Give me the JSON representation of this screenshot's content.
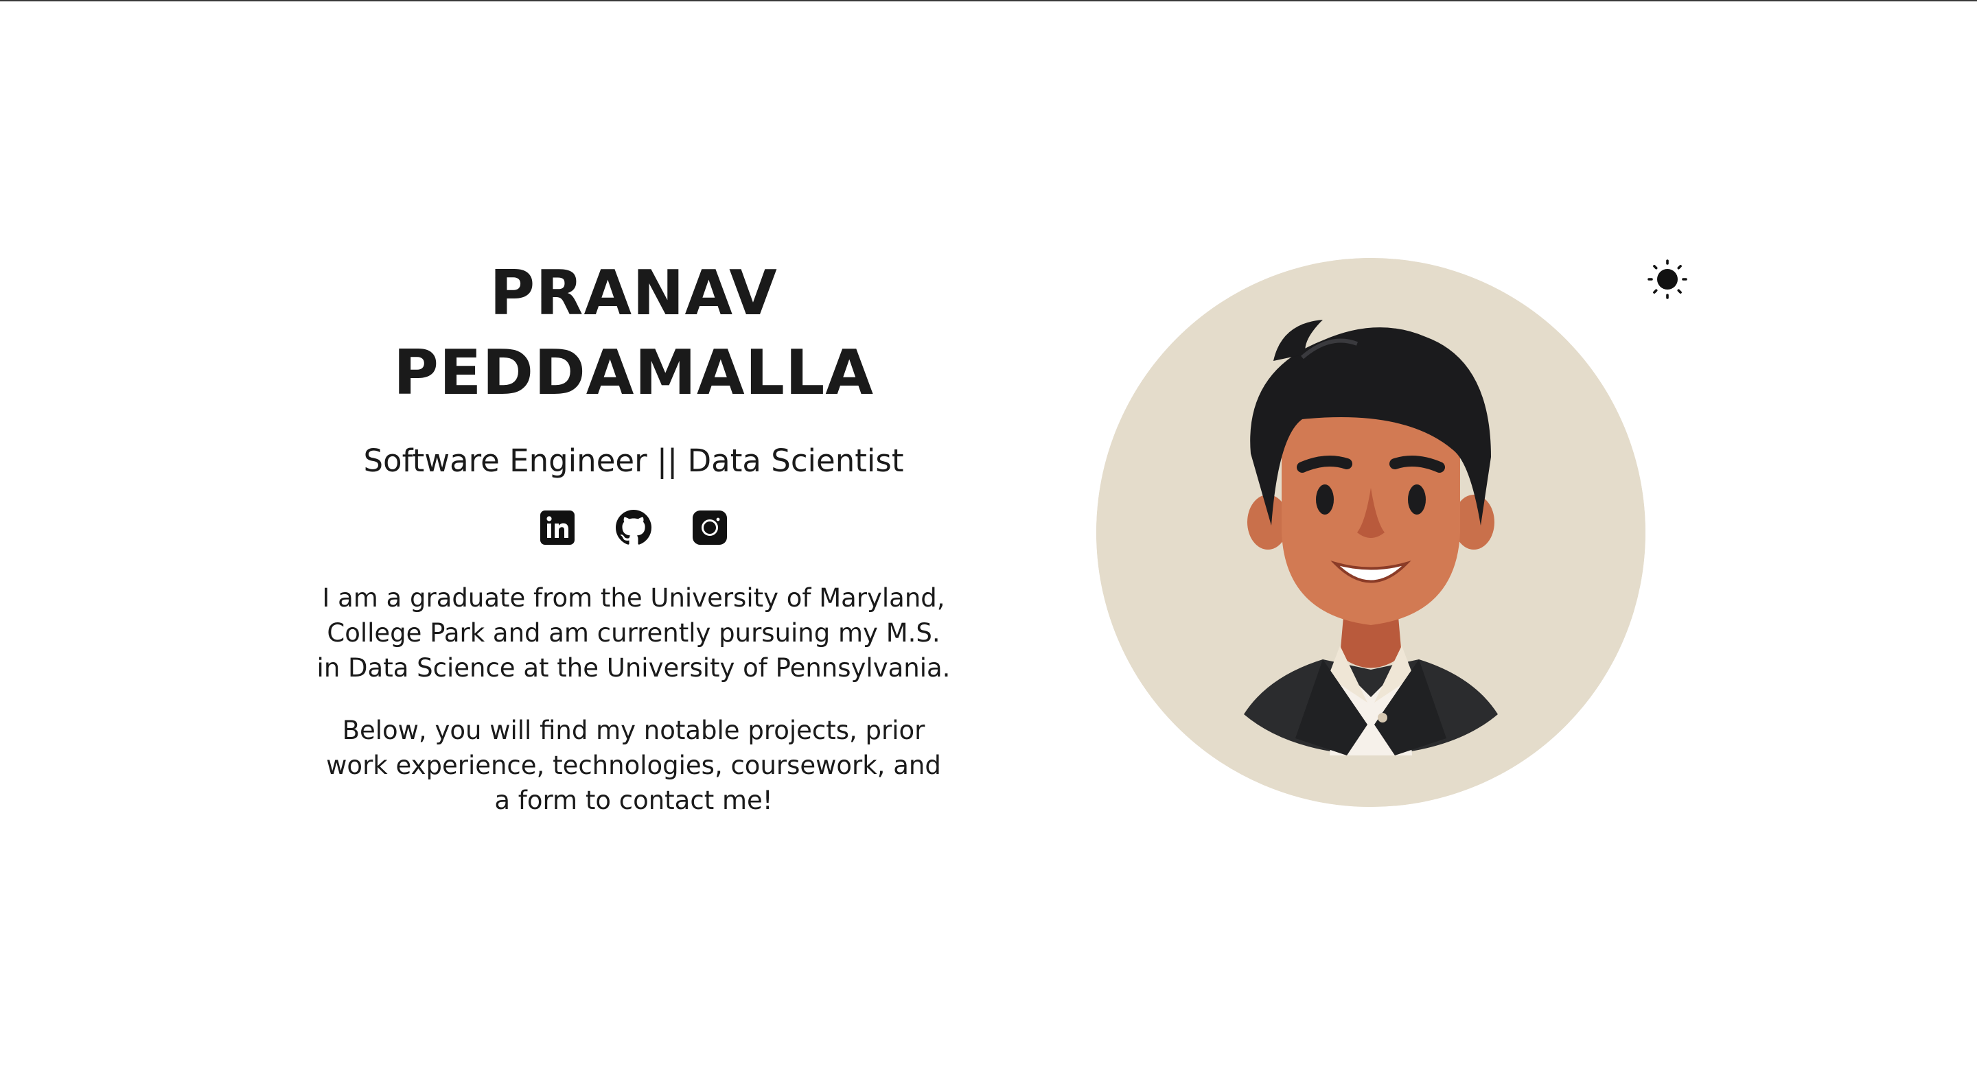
{
  "hero": {
    "name_line1": "PRANAV",
    "name_line2": "PEDDAMALLA",
    "subtitle": "Software Engineer || Data Scientist",
    "bio_paragraph1": "I am a graduate from the University of Maryland, College Park and am currently pursuing my M.S. in Data Science at the University of Pennsylvania.",
    "bio_paragraph2": "Below, you will find my notable projects, prior work experience, technologies, coursework, and a form to contact me!"
  },
  "socials": [
    {
      "icon": "linkedin-icon"
    },
    {
      "icon": "github-icon"
    },
    {
      "icon": "instagram-icon"
    }
  ],
  "theme_toggle": {
    "icon": "sun-icon"
  },
  "avatar": {
    "icon": "avatar-illustration"
  },
  "colors": {
    "text": "#1a1a1a",
    "background": "#ffffff",
    "avatar_bg": "#e4dccb",
    "skin": "#d27a53",
    "hair": "#1b1b1d",
    "jacket": "#2b2c2e"
  }
}
